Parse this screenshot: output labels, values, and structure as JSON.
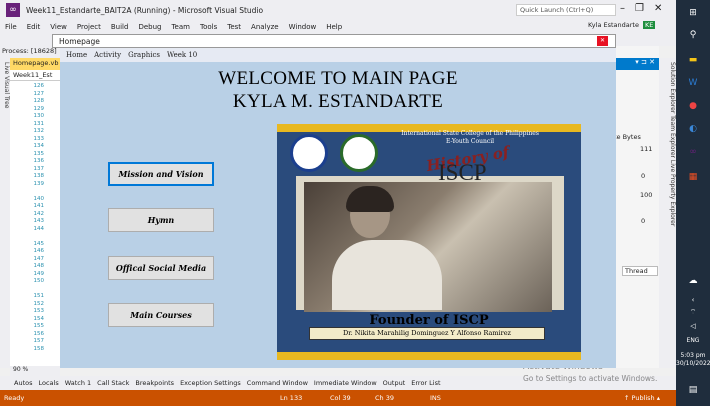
{
  "vs": {
    "title": "Week11_Estandarte_BAIT2A (Running) - Microsoft Visual Studio",
    "quick_launch": "Quick Launch (Ctrl+Q)",
    "menu": [
      "File",
      "Edit",
      "View",
      "Project",
      "Build",
      "Debug",
      "Team",
      "Tools",
      "Test",
      "Analyze",
      "Window",
      "Help"
    ],
    "user": "Kyla Estandarte",
    "user_badge": "KE",
    "process_label": "Process: [18628]",
    "left_strip": "Live Visual Tree",
    "doc_tab": "Homepage.vb",
    "crumb": "Week11_Est",
    "line_numbers": "126\n127\n128\n129\n130\n131\n132\n133\n134\n135\n136\n137\n138\n139\n\n140\n141\n142\n143\n144\n\n145\n146\n147\n148\n149\n150\n\n151\n152\n153\n154\n155\n156\n157\n158",
    "zoom": "90 %",
    "right_strip": "Solution Explorer   Team Explorer   Live Property Explorer",
    "rp_bytes": "ate Bytes",
    "rp_v111": "111",
    "rp_v0a": "0",
    "rp_v100": "100",
    "rp_v0b": "0",
    "rp_thread": "Thread",
    "bottom_tabs": [
      "Autos",
      "Locals",
      "Watch 1",
      "Call Stack",
      "Breakpoints",
      "Exception Settings",
      "Command Window",
      "Immediate Window",
      "Output",
      "Error List"
    ],
    "status": {
      "ready": "Ready",
      "ln": "Ln 133",
      "col": "Col 39",
      "ch": "Ch 39",
      "ins": "INS",
      "publish": "↑ Publish ▴"
    },
    "activate_line1": "Activate Windows",
    "activate_line2": "Go to Settings to activate Windows."
  },
  "taskbar": {
    "lang": "ENG",
    "time": "5:03 pm",
    "date": "30/10/2022"
  },
  "app": {
    "window_title": "Homepage",
    "menu": [
      "Home",
      "Activity",
      "Graphics",
      "Week 10"
    ],
    "welcome_line1": "WELCOME TO MAIN PAGE",
    "welcome_line2": "KYLA M. ESTANDARTE",
    "buttons": {
      "mission": "Mission and Vision",
      "hymn": "Hymn",
      "social": "Offical Social Media",
      "courses": "Main Courses"
    },
    "poster": {
      "school": "International State College of the Philippines",
      "council": "E-Youth Council",
      "history": "History of",
      "iscp": "ISCP",
      "founder": "Founder of ISCP",
      "founder_name": "Dr. Nikita Marahilig Dominguez Y Alfonso Ramirez"
    }
  },
  "colors": {
    "status_bar": "#ca5100",
    "app_background": "#b9d0e6",
    "accent": "#007acc"
  }
}
